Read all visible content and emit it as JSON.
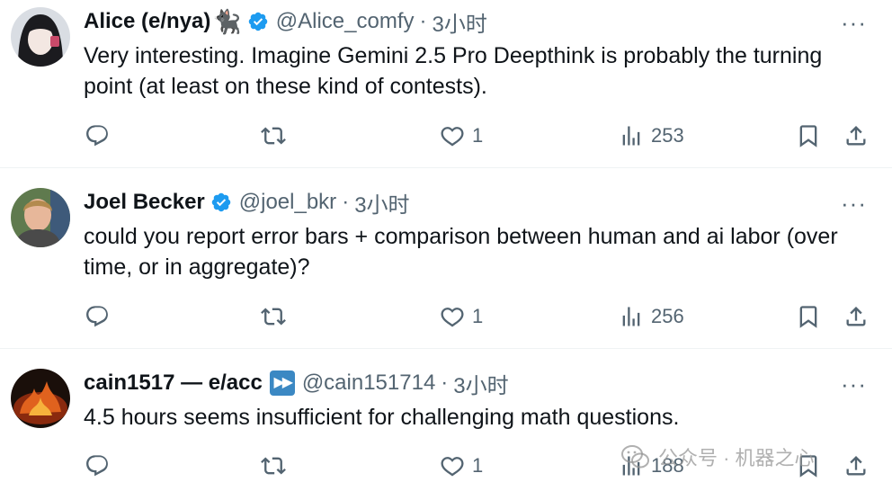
{
  "tweets": [
    {
      "display_name": "Alice (e/nya)",
      "handle": "@Alice_comfy",
      "separator": "·",
      "time": "3小时",
      "text": "Very interesting. Imagine Gemini 2.5 Pro Deepthink is probably the turning point (at least on these kind of contests).",
      "likes": "1",
      "views": "253"
    },
    {
      "display_name": "Joel Becker",
      "handle": "@joel_bkr",
      "separator": "·",
      "time": "3小时",
      "text": "could you report error bars + comparison between human and ai labor (over time, or in aggregate)?",
      "likes": "1",
      "views": "256"
    },
    {
      "display_name": "cain1517 — e/acc",
      "handle": "@cain151714",
      "separator": "·",
      "time": "3小时",
      "text": "4.5 hours seems insufficient for challenging math questions.",
      "likes": "1",
      "views": "188"
    }
  ],
  "more_label": "···",
  "cat_emoji": "🐈‍⬛",
  "watermark": "公众号 · 机器之心",
  "colors": {
    "text": "#0f1419",
    "secondary": "#536471",
    "verified": "#1d9bf0",
    "divider": "#eff3f4"
  }
}
